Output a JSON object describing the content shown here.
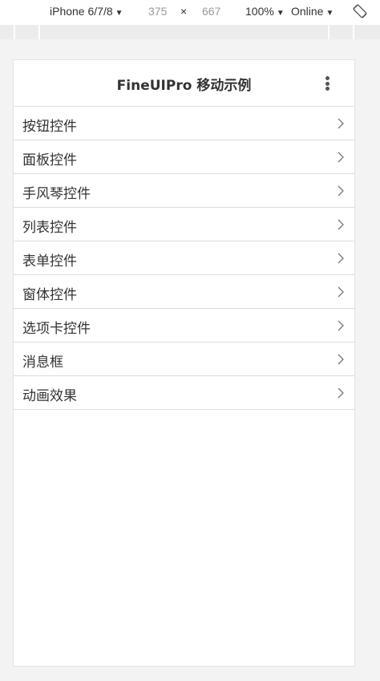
{
  "devtools": {
    "device": "iPhone 6/7/8",
    "width": "375",
    "times": "×",
    "height": "667",
    "zoom": "100%",
    "network": "Online",
    "caret": "▼"
  },
  "app": {
    "title": "FineUIPro 移动示例"
  },
  "menu": {
    "items": [
      {
        "label": "按钮控件"
      },
      {
        "label": "面板控件"
      },
      {
        "label": "手风琴控件"
      },
      {
        "label": "列表控件"
      },
      {
        "label": "表单控件"
      },
      {
        "label": "窗体控件"
      },
      {
        "label": "选项卡控件"
      },
      {
        "label": "消息框"
      },
      {
        "label": "动画效果"
      }
    ]
  },
  "icons": {
    "rotate": "rotate-icon",
    "more": "more-vertical-icon",
    "chevron": "chevron-right-icon"
  }
}
